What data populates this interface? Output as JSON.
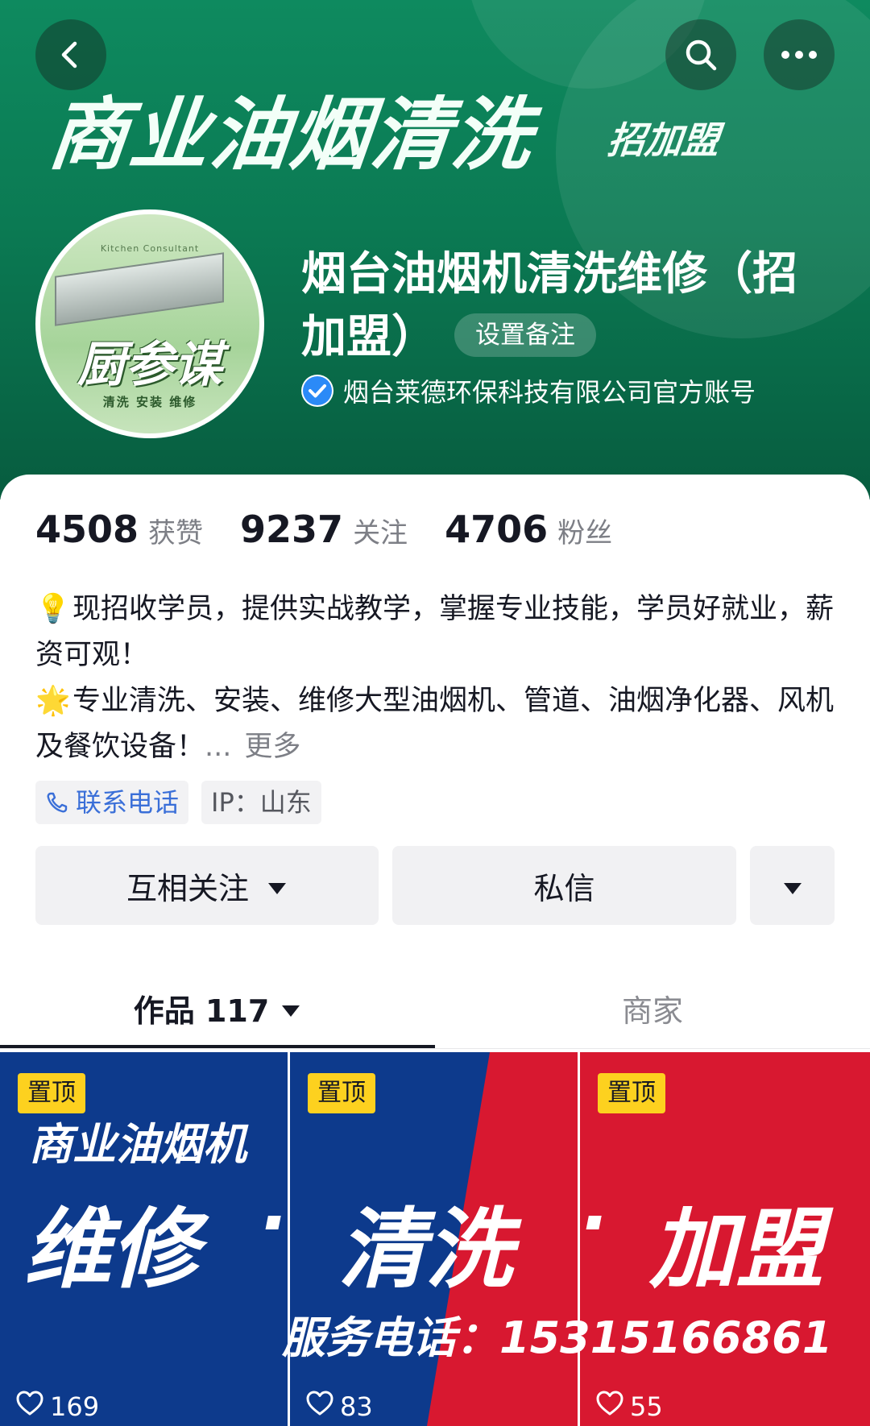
{
  "header": {
    "banner_title": "商业油烟清洗",
    "banner_subtitle": "招加盟",
    "back_icon": "chevron-left-icon",
    "search_icon": "search-icon",
    "more_icon": "more-dots-icon"
  },
  "avatar": {
    "top_text": "Kitchen Consultant",
    "main_text": "厨参谋",
    "bottom_text": "清洗 安装 维修"
  },
  "profile": {
    "name": "烟台油烟机清洗维修（招加盟）",
    "remark_button": "设置备注",
    "verified_text": "烟台莱德环保科技有限公司官方账号"
  },
  "stats": [
    {
      "value": "4508",
      "label": "获赞"
    },
    {
      "value": "9237",
      "label": "关注"
    },
    {
      "value": "4706",
      "label": "粉丝"
    }
  ],
  "bio": {
    "line1": "现招收学员，提供实战教学，掌握专业技能，学员好就业，薪资可观！",
    "line2": "专业清洗、安装、维修大型油烟机、管道、油烟净化器、风机及餐饮设备！",
    "ellipsis": "...",
    "more_label": "更多",
    "emoji1": "💡",
    "emoji2": "🌟"
  },
  "tags": {
    "phone": "联系电话",
    "ip": "IP：山东"
  },
  "actions": {
    "follow": "互相关注",
    "message": "私信"
  },
  "tabs": {
    "works": "作品 117",
    "shop": "商家"
  },
  "videos": {
    "line1": "商业油烟机",
    "word1": "维修",
    "word2": "清洗",
    "word3": "加盟",
    "dot": "·",
    "phone_line": "服务电话：15315166861",
    "items": [
      {
        "pin": "置顶",
        "likes": "169"
      },
      {
        "pin": "置顶",
        "likes": "83"
      },
      {
        "pin": "置顶",
        "likes": "55"
      }
    ]
  },
  "colors": {
    "banner_green": "#0b7a53",
    "video_blue": "#0d3a8c",
    "video_red": "#d81830",
    "pin_yellow": "#fdd11f",
    "link_blue": "#3a6fd8"
  }
}
